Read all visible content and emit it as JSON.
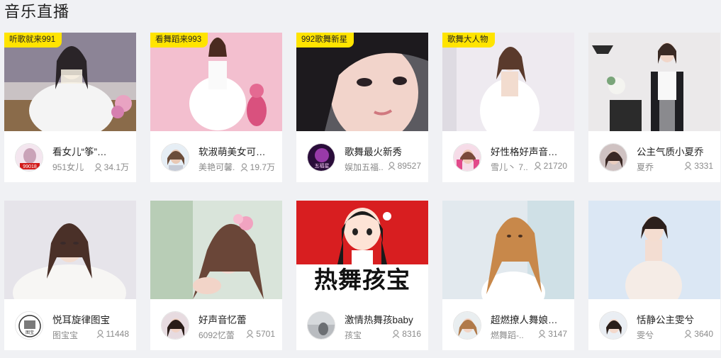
{
  "section_title": "音乐直播",
  "icons": {
    "viewer": "user-icon"
  },
  "colors": {
    "tag_bg": "#ffe400",
    "page_bg": "#f0f1f4",
    "card_bg": "#ffffff"
  },
  "cards": [
    {
      "tag": "听歌就来991",
      "title": "看女儿“筝”…",
      "host": "951女儿",
      "viewers": "34.1万",
      "avatar_text": "99018"
    },
    {
      "tag": "看舞蹈来993",
      "title": "软淑萌美女可…",
      "host": "美艳可馨.",
      "viewers": "19.7万"
    },
    {
      "tag": "992歌舞新星",
      "title": "歌舞最火新秀",
      "host": "娱加五福..",
      "viewers": "89527",
      "avatar_text": "五福星"
    },
    {
      "tag": "歌舞大人物",
      "title": "好性格好声音…",
      "host": "雪儿丶 7..",
      "viewers": "21720"
    },
    {
      "tag": "",
      "title": "公主气质小夏乔",
      "host": "夏乔",
      "viewers": "3331"
    },
    {
      "tag": "",
      "title": "悦耳旋律图宝",
      "host": "图宝宝",
      "viewers": "11448",
      "avatar_text": "图宝"
    },
    {
      "tag": "",
      "title": "好声音忆蕾",
      "host": "6092忆蕾",
      "viewers": "5701"
    },
    {
      "tag": "",
      "title": "激情热舞孩baby",
      "host": "孩宝",
      "viewers": "8316",
      "banner_text": "热舞孩宝"
    },
    {
      "tag": "",
      "title": "超燃撩人舞娘…",
      "host": "燃舞蹈-..",
      "viewers": "3147"
    },
    {
      "tag": "",
      "title": "恬静公主雯兮",
      "host": "雯兮",
      "viewers": "3640"
    }
  ]
}
